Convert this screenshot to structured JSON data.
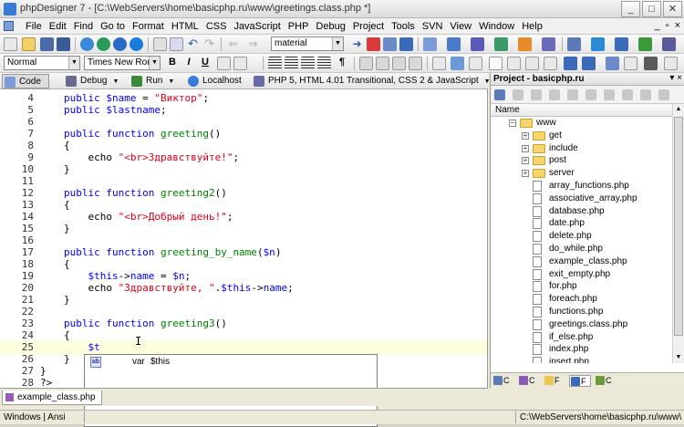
{
  "window": {
    "title": "phpDesigner 7 - [C:\\WebServers\\home\\basicphp.ru\\www\\greetings.class.php *]",
    "controls": [
      "_",
      "□",
      "✕"
    ]
  },
  "menu": {
    "items": [
      "File",
      "Edit",
      "Find",
      "Go to",
      "Format",
      "HTML",
      "CSS",
      "JavaScript",
      "PHP",
      "Debug",
      "Project",
      "Tools",
      "SVN",
      "View",
      "Window",
      "Help"
    ],
    "mdi_controls": [
      "_",
      "▫",
      "×"
    ]
  },
  "toolbar": {
    "theme_combo": "material",
    "style_combo": "Normal",
    "font_combo": "Times New Roman",
    "format_buttons": [
      "B",
      "I",
      "U",
      "¶"
    ]
  },
  "viewbar": {
    "code_label": "Code",
    "debug_label": "Debug",
    "run_label": "Run",
    "localhost_label": "Localhost",
    "syntax_label": "PHP 5, HTML 4.01 Transitional, CSS 2 & JavaScript"
  },
  "editor": {
    "lines": [
      {
        "n": "4",
        "t": [
          [
            "k",
            "public "
          ],
          [
            "v",
            "$name"
          ],
          [
            "o",
            " = "
          ],
          [
            "s",
            "\"Виктор\""
          ],
          [
            "o",
            ";"
          ]
        ]
      },
      {
        "n": "5",
        "t": [
          [
            "k",
            "public "
          ],
          [
            "v",
            "$lastname"
          ],
          [
            "o",
            ";"
          ]
        ]
      },
      {
        "n": "6",
        "t": []
      },
      {
        "n": "7",
        "t": [
          [
            "k",
            "public function "
          ],
          [
            "f",
            "greeting"
          ],
          [
            "o",
            "()"
          ]
        ]
      },
      {
        "n": "8",
        "t": [
          [
            "o",
            "{"
          ]
        ]
      },
      {
        "n": "9",
        "t": [
          [
            "o",
            "    echo "
          ],
          [
            "s",
            "\"<br>Здравствуйте!\""
          ],
          [
            "o",
            ";"
          ]
        ]
      },
      {
        "n": "10",
        "t": [
          [
            "o",
            "}"
          ]
        ]
      },
      {
        "n": "11",
        "t": []
      },
      {
        "n": "12",
        "t": [
          [
            "k",
            "public function "
          ],
          [
            "f",
            "greeting2"
          ],
          [
            "o",
            "()"
          ]
        ]
      },
      {
        "n": "13",
        "t": [
          [
            "o",
            "{"
          ]
        ]
      },
      {
        "n": "14",
        "t": [
          [
            "o",
            "    echo "
          ],
          [
            "s",
            "\"<br>Добрый день!\""
          ],
          [
            "o",
            ";"
          ]
        ]
      },
      {
        "n": "15",
        "t": [
          [
            "o",
            "}"
          ]
        ]
      },
      {
        "n": "16",
        "t": []
      },
      {
        "n": "17",
        "t": [
          [
            "k",
            "public function "
          ],
          [
            "f",
            "greeting_by_name"
          ],
          [
            "o",
            "("
          ],
          [
            "v",
            "$n"
          ],
          [
            "o",
            ")"
          ]
        ]
      },
      {
        "n": "18",
        "t": [
          [
            "o",
            "{"
          ]
        ]
      },
      {
        "n": "19",
        "t": [
          [
            "v",
            "    $this"
          ],
          [
            "o",
            "->"
          ],
          [
            "v",
            "name"
          ],
          [
            "o",
            " = "
          ],
          [
            "v",
            "$n"
          ],
          [
            "o",
            ";"
          ]
        ]
      },
      {
        "n": "20",
        "t": [
          [
            "o",
            "    echo "
          ],
          [
            "s",
            "\"Здравствуйте, \""
          ],
          [
            "o",
            "."
          ],
          [
            "v",
            "$this"
          ],
          [
            "o",
            "->"
          ],
          [
            "v",
            "name"
          ],
          [
            "o",
            ";"
          ]
        ]
      },
      {
        "n": "21",
        "t": [
          [
            "o",
            "}"
          ]
        ]
      },
      {
        "n": "22",
        "t": []
      },
      {
        "n": "23",
        "t": [
          [
            "k",
            "public function "
          ],
          [
            "f",
            "greeting3"
          ],
          [
            "o",
            "()"
          ]
        ]
      },
      {
        "n": "24",
        "t": [
          [
            "o",
            "{"
          ]
        ]
      },
      {
        "n": "25",
        "t": [
          [
            "v",
            "    $t"
          ]
        ],
        "current": true
      },
      {
        "n": "26",
        "t": [
          [
            "o",
            "}"
          ]
        ]
      },
      {
        "n": "27",
        "t": [
          [
            "o",
            "}"
          ]
        ],
        "indent": 1
      },
      {
        "n": "28",
        "t": [
          [
            "o",
            "?>"
          ]
        ],
        "indent": 1
      }
    ],
    "autocomplete": {
      "kind": "var",
      "name": "$this",
      "icon_label": "ab"
    }
  },
  "doctab": {
    "label": "example_class.php"
  },
  "statusbar": {
    "encoding": "Windows | Ansi",
    "path": "C:\\WebServers\\home\\basicphp.ru\\www\\"
  },
  "project": {
    "title": "Project - basicphp.ru",
    "column": "Name",
    "nodes": [
      {
        "label": "www",
        "type": "folder",
        "level": 0,
        "exp": "−"
      },
      {
        "label": "get",
        "type": "folder",
        "level": 1,
        "exp": "+"
      },
      {
        "label": "include",
        "type": "folder",
        "level": 1,
        "exp": "+"
      },
      {
        "label": "post",
        "type": "folder",
        "level": 1,
        "exp": "+"
      },
      {
        "label": "server",
        "type": "folder",
        "level": 1,
        "exp": "+"
      },
      {
        "label": "array_functions.php",
        "type": "file",
        "level": 1
      },
      {
        "label": "associative_array.php",
        "type": "file",
        "level": 1
      },
      {
        "label": "database.php",
        "type": "file",
        "level": 1
      },
      {
        "label": "date.php",
        "type": "file",
        "level": 1
      },
      {
        "label": "delete.php",
        "type": "file",
        "level": 1
      },
      {
        "label": "do_while.php",
        "type": "file",
        "level": 1
      },
      {
        "label": "example_class.php",
        "type": "file",
        "level": 1
      },
      {
        "label": "exit_empty.php",
        "type": "file",
        "level": 1
      },
      {
        "label": "for.php",
        "type": "file",
        "level": 1
      },
      {
        "label": "foreach.php",
        "type": "file",
        "level": 1
      },
      {
        "label": "functions.php",
        "type": "file",
        "level": 1
      },
      {
        "label": "greetings.class.php",
        "type": "file",
        "level": 1
      },
      {
        "label": "if_else.php",
        "type": "file",
        "level": 1
      },
      {
        "label": "index.php",
        "type": "file",
        "level": 1
      },
      {
        "label": "insert.php",
        "type": "file",
        "level": 1
      }
    ],
    "tabs": [
      "C",
      "C",
      "F",
      "F",
      "C"
    ]
  }
}
